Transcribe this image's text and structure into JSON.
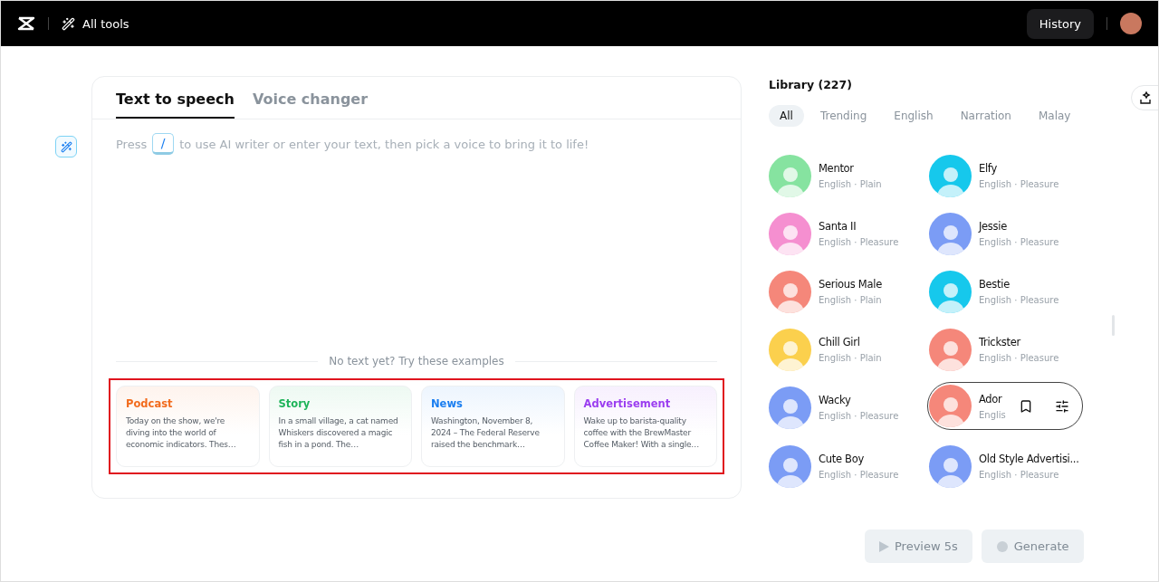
{
  "topbar": {
    "tools_label": "All tools",
    "history_button": "History"
  },
  "editor": {
    "tabs": [
      {
        "label": "Text to speech",
        "selected": true
      },
      {
        "label": "Voice changer",
        "selected": false
      }
    ],
    "prompt": {
      "before": "Press",
      "key": "/",
      "after": "to use AI writer or enter your text, then pick a voice to bring it to life!"
    },
    "examples_caption": "No text yet? Try these examples",
    "examples_highlighted": true,
    "examples": [
      {
        "title": "Podcast",
        "color": "#f26b1d",
        "text": "Today on the show, we're diving into the world of economic indicators. Thes…"
      },
      {
        "title": "Story",
        "color": "#1fb45a",
        "text": "In a small village, a cat named Whiskers discovered a magic fish in a pond. The…"
      },
      {
        "title": "News",
        "color": "#1a7ef0",
        "text": "Washington, November 8, 2024 – The Federal Reserve raised the benchmark…"
      },
      {
        "title": "Advertisement",
        "color": "#9b3ef0",
        "text": "Wake up to barista-quality coffee with the BrewMaster Coffee Maker! With a single…"
      }
    ]
  },
  "library": {
    "title": "Library (227)",
    "filters": [
      {
        "label": "All",
        "selected": true
      },
      {
        "label": "Trending",
        "selected": false
      },
      {
        "label": "English",
        "selected": false
      },
      {
        "label": "Narration",
        "selected": false
      },
      {
        "label": "Malay",
        "selected": false
      }
    ],
    "voices": [
      {
        "name": "Mentor",
        "meta": "English · Plain",
        "color": "#86e3a0",
        "hovered": false
      },
      {
        "name": "Elfy",
        "meta": "English · Pleasure",
        "color": "#16c8ec",
        "hovered": false
      },
      {
        "name": "Santa II",
        "meta": "English · Pleasure",
        "color": "#f58fd0",
        "hovered": false
      },
      {
        "name": "Jessie",
        "meta": "English · Pleasure",
        "color": "#7b9cf5",
        "hovered": false
      },
      {
        "name": "Serious Male",
        "meta": "English · Plain",
        "color": "#f5877a",
        "hovered": false
      },
      {
        "name": "Bestie",
        "meta": "English · Pleasure",
        "color": "#16c8ec",
        "hovered": false
      },
      {
        "name": "Chill Girl",
        "meta": "English · Plain",
        "color": "#fbd04d",
        "hovered": false
      },
      {
        "name": "Trickster",
        "meta": "English · Pleasure",
        "color": "#f5877a",
        "hovered": false
      },
      {
        "name": "Wacky",
        "meta": "English · Pleasure",
        "color": "#7b9cf5",
        "hovered": false
      },
      {
        "name": "Ador",
        "meta": "Englis",
        "color": "#f5877a",
        "hovered": true
      },
      {
        "name": "Cute Boy",
        "meta": "English · Pleasure",
        "color": "#7b9cf5",
        "hovered": false
      },
      {
        "name": "Old Style Advertisi...",
        "meta": "English · Pleasure",
        "color": "#7b9cf5",
        "hovered": false
      }
    ]
  },
  "actions": [
    {
      "kind": "preview",
      "label": "Preview 5s",
      "disabled": true
    },
    {
      "kind": "generate",
      "label": "Generate",
      "disabled": true
    }
  ]
}
